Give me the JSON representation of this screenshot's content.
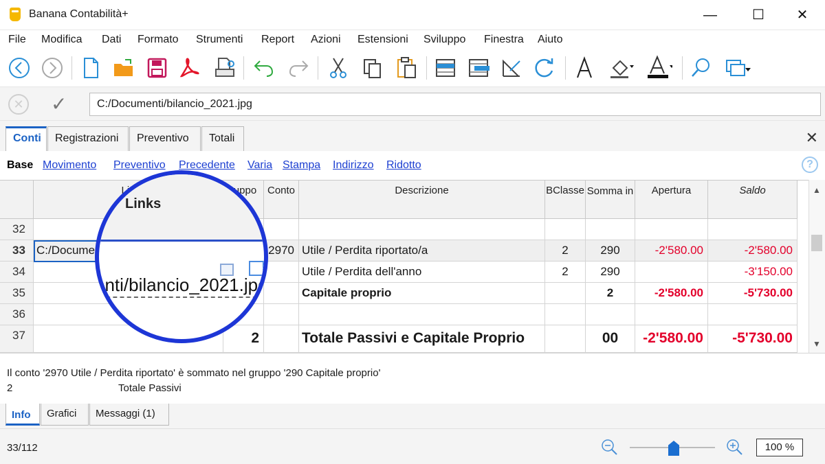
{
  "window": {
    "title": "Banana Contabilità+",
    "minimize": "—",
    "maximize": "☐",
    "close": "✕"
  },
  "menu": [
    "File",
    "Modifica",
    "Dati",
    "Formato",
    "Strumenti",
    "Report",
    "Azioni",
    "Estensioni",
    "Sviluppo",
    "Finestra",
    "Aiuto"
  ],
  "toolbar": {
    "icons": [
      "back-icon",
      "forward-icon",
      "new-file-icon",
      "open-folder-icon",
      "save-icon",
      "pdf-icon",
      "print-preview-icon",
      "undo-icon",
      "redo-icon",
      "cut-icon",
      "copy-icon",
      "paste-icon",
      "insert-row-icon",
      "move-row-icon",
      "edit-row-icon",
      "recalculate-icon",
      "font-icon",
      "fill-color-icon",
      "text-color-icon",
      "search-icon",
      "window-icon"
    ]
  },
  "formula_bar": {
    "value": "C:/Documenti/bilancio_2021.jpg"
  },
  "table_tabs": [
    "Conti",
    "Registrazioni",
    "Preventivo",
    "Totali"
  ],
  "views": [
    "Base",
    "Movimento",
    "Preventivo",
    "Precedente",
    "Varia",
    "Stampa",
    "Indirizzo",
    "Ridotto"
  ],
  "grid": {
    "headers": {
      "links": "Lin",
      "gruppo": "ruppo",
      "conto": "Conto",
      "descrizione": "Descrizione",
      "bclasse": "BClasse",
      "somma_in": "Somma in",
      "apertura": "Apertura",
      "saldo": "Saldo"
    },
    "rows": [
      {
        "num": "32",
        "links": "",
        "gruppo": "",
        "conto": "",
        "descrizione": "",
        "bclasse": "",
        "somma_in": "",
        "apertura": "",
        "saldo": ""
      },
      {
        "num": "33",
        "links": "C:/Docume",
        "gruppo": "",
        "conto": "2970",
        "descrizione": "Utile / Perdita riportato/a",
        "bclasse": "2",
        "somma_in": "290",
        "apertura": "-2'580.00",
        "saldo": "-2'580.00"
      },
      {
        "num": "34",
        "links": "",
        "gruppo": "",
        "conto": "",
        "descrizione": "Utile / Perdita dell'anno",
        "bclasse": "2",
        "somma_in": "290",
        "apertura": "",
        "saldo": "-3'150.00"
      },
      {
        "num": "35",
        "links": "",
        "gruppo": "",
        "conto": "",
        "descrizione": "Capitale proprio",
        "bclasse": "",
        "somma_in": "2",
        "apertura": "-2'580.00",
        "saldo": "-5'730.00"
      },
      {
        "num": "36",
        "links": "",
        "gruppo": "",
        "conto": "",
        "descrizione": "",
        "bclasse": "",
        "somma_in": "",
        "apertura": "",
        "saldo": ""
      },
      {
        "num": "37",
        "links": "",
        "gruppo": "2",
        "conto": "",
        "descrizione": "Totale Passivi e Capitale Proprio",
        "bclasse": "",
        "somma_in": "00",
        "apertura": "-2'580.00",
        "saldo": "-5'730.00"
      }
    ]
  },
  "magnifier": {
    "header": "Links",
    "text": "enti/bilancio_2021.jpg"
  },
  "info": {
    "line1": "Il conto '2970 Utile / Perdita riportato' è sommato nel gruppo '290 Capitale proprio'",
    "line2_code": "2",
    "line2_text": "Totale Passivi"
  },
  "info_tabs": [
    "Info",
    "Grafici",
    "Messaggi (1)"
  ],
  "status": {
    "position": "33/112",
    "zoom": "100 %",
    "zoom_level_percent": 100
  },
  "colors": {
    "accent": "#1b62c4",
    "negative": "#e3002b",
    "magnifier_ring": "#1d36d6",
    "link": "#1c3fd1"
  }
}
